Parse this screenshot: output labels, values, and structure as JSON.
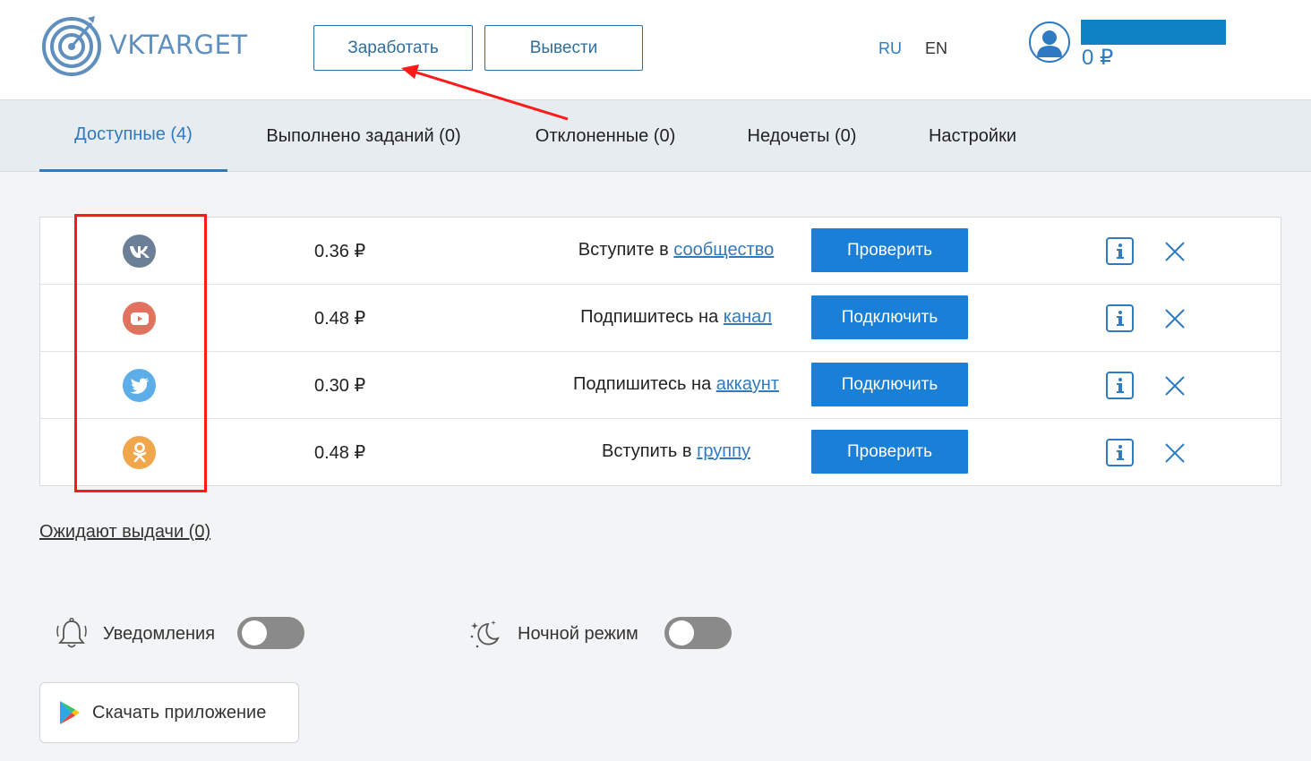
{
  "header": {
    "logo_text": "VKTARGET",
    "earn_label": "Заработать",
    "withdraw_label": "Вывести",
    "lang_ru": "RU",
    "lang_en": "EN",
    "balance": "0 ₽"
  },
  "tabs": [
    {
      "label": "Доступные (4)",
      "active": true
    },
    {
      "label": "Выполнено заданий (0)"
    },
    {
      "label": "Отклоненные (0)"
    },
    {
      "label": "Недочеты (0)"
    },
    {
      "label": "Настройки"
    }
  ],
  "tasks": [
    {
      "network": "vk",
      "icon": "vk-icon",
      "color": "#6b8096",
      "price": "0.36 ₽",
      "text": "Вступите в ",
      "link": "сообщество",
      "action": "Проверить"
    },
    {
      "network": "youtube",
      "icon": "youtube-icon",
      "color": "#e0725f",
      "price": "0.48 ₽",
      "text": "Подпишитесь на ",
      "link": "канал",
      "action": "Подключить"
    },
    {
      "network": "twitter",
      "icon": "twitter-icon",
      "color": "#5daee8",
      "price": "0.30 ₽",
      "text": "Подпишитесь на ",
      "link": "аккаунт",
      "action": "Подключить"
    },
    {
      "network": "odnoklassniki",
      "icon": "odnoklassniki-icon",
      "color": "#f0a64a",
      "price": "0.48 ₽",
      "text": "Вступить в ",
      "link": "группу",
      "action": "Проверить"
    }
  ],
  "pending_label": "Ожидают выдачи (0)",
  "settings": {
    "notifications_label": "Уведомления",
    "night_mode_label": "Ночной режим"
  },
  "download_label": "Скачать приложение",
  "colors": {
    "accent": "#2f7bc2",
    "button_blue": "#1a7fd6",
    "annotation_red": "#ff1a1a"
  }
}
